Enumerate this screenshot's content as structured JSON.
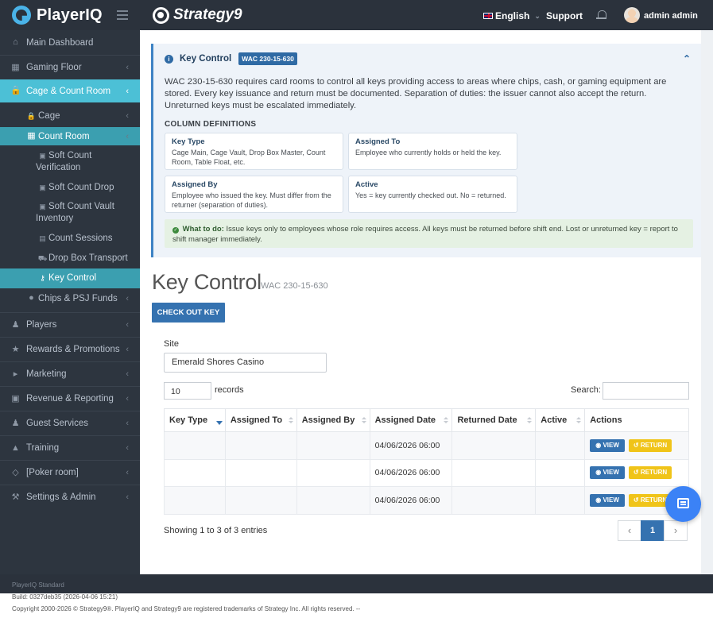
{
  "topbar": {
    "brand": "PlayerIQ",
    "partner": "Strategy9",
    "language": "English",
    "support": "Support",
    "user": "admin admin"
  },
  "sidebar": {
    "items": [
      {
        "label": "Main Dashboard",
        "icon": "home-icon"
      },
      {
        "label": "Gaming Floor",
        "icon": "grid-icon"
      },
      {
        "label": "Cage & Count Room",
        "icon": "lock-icon"
      },
      {
        "label": "Cage",
        "icon": "lock-icon"
      },
      {
        "label": "Count Room",
        "icon": "calculator-icon"
      },
      {
        "label": "Soft Count Verification",
        "icon": "money-icon"
      },
      {
        "label": "Soft Count Drop",
        "icon": "money-icon"
      },
      {
        "label": "Soft Count Vault Inventory",
        "icon": "money-icon"
      },
      {
        "label": "Count Sessions",
        "icon": "list-icon"
      },
      {
        "label": "Drop Box Transport",
        "icon": "truck-icon"
      },
      {
        "label": "Key Control",
        "icon": "key-icon"
      },
      {
        "label": "Chips & PSJ Funds",
        "icon": "chip-icon"
      },
      {
        "label": "Players",
        "icon": "user-icon"
      },
      {
        "label": "Rewards & Promotions",
        "icon": "star-icon"
      },
      {
        "label": "Marketing",
        "icon": "megaphone-icon"
      },
      {
        "label": "Revenue & Reporting",
        "icon": "money-icon"
      },
      {
        "label": "Guest Services",
        "icon": "users-icon"
      },
      {
        "label": "Training",
        "icon": "graduation-cap-icon"
      },
      {
        "label": "[Poker room]",
        "icon": "diamond-icon"
      },
      {
        "label": "Settings & Admin",
        "icon": "wrench-icon"
      }
    ]
  },
  "info": {
    "title": "Key Control",
    "badge": "WAC 230-15-630",
    "description": "WAC 230-15-630 requires card rooms to control all keys providing access to areas where chips, cash, or gaming equipment are stored. Every key issuance and return must be documented. Separation of duties: the issuer cannot also accept the return. Unreturned keys must be escalated immediately.",
    "coldefs_title": "COLUMN DEFINITIONS",
    "defs": [
      {
        "title": "Key Type",
        "text": "Cage Main, Cage Vault, Drop Box Master, Count Room, Table Float, etc."
      },
      {
        "title": "Assigned To",
        "text": "Employee who currently holds or held the key."
      },
      {
        "title": "Assigned By",
        "text": "Employee who issued the key. Must differ from the returner (separation of duties)."
      },
      {
        "title": "Active",
        "text": "Yes = key currently checked out. No = returned."
      }
    ],
    "whattodo_label": "What to do:",
    "whattodo_text": "Issue keys only to employees whose role requires access. All keys must be returned before shift end. Lost or unreturned key = report to shift manager immediately."
  },
  "page": {
    "title": "Key Control",
    "subtitle": "WAC 230-15-630",
    "checkout_button": "CHECK OUT KEY",
    "site_label": "Site",
    "site_value": "Emerald Shores Casino",
    "records_value": "10",
    "records_label": "records",
    "search_label": "Search:"
  },
  "table": {
    "columns": [
      "Key Type",
      "Assigned To",
      "Assigned By",
      "Assigned Date",
      "Returned Date",
      "Active",
      "Actions"
    ],
    "rows": [
      {
        "key_type": "",
        "assigned_to": "",
        "assigned_by": "",
        "assigned_date": "04/06/2026 06:00",
        "returned_date": "",
        "active": ""
      },
      {
        "key_type": "",
        "assigned_to": "",
        "assigned_by": "",
        "assigned_date": "04/06/2026 06:00",
        "returned_date": "",
        "active": ""
      },
      {
        "key_type": "",
        "assigned_to": "",
        "assigned_by": "",
        "assigned_date": "04/06/2026 06:00",
        "returned_date": "",
        "active": ""
      }
    ],
    "view_label": "VIEW",
    "return_label": "RETURN",
    "showing": "Showing 1 to 3 of 3 entries",
    "prev": "‹",
    "page": "1",
    "next": "›"
  },
  "footer": {
    "edition": "PlayerIQ Standard",
    "build": "Build: 0327deb35 (2026-04-06 15:21)",
    "copyright": "Copyright 2000-2026 © Strategy9®. PlayerIQ and Strategy9 are registered trademarks of Strategy Inc. All rights reserved. --"
  },
  "colors": {
    "accent": "#4cc0d6",
    "primary": "#3572b0",
    "warning": "#f0c419",
    "sidebar_bg": "#2d353f"
  }
}
